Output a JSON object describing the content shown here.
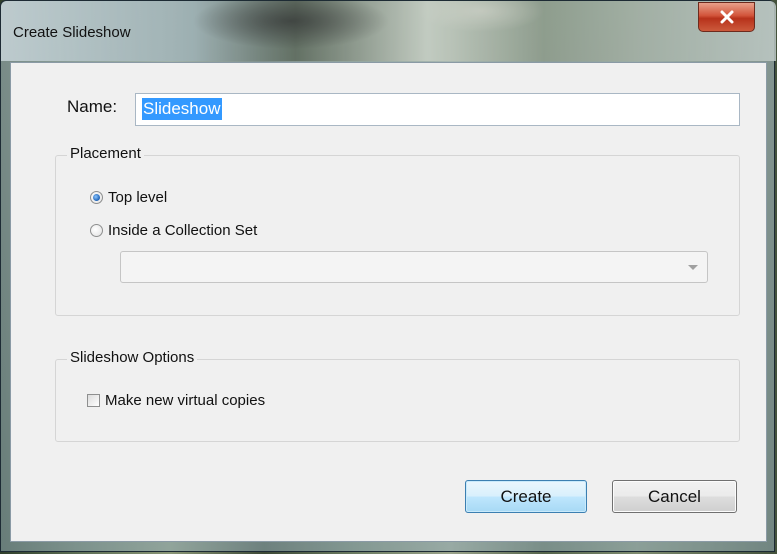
{
  "window": {
    "title": "Create Slideshow",
    "close_icon": "close-x-icon"
  },
  "name_field": {
    "label": "Name:",
    "value": "Slideshow",
    "value_selected": true
  },
  "placement": {
    "legend": "Placement",
    "options": [
      {
        "label": "Top level",
        "checked": true
      },
      {
        "label": "Inside a Collection Set",
        "checked": false
      }
    ],
    "collection_set_value": ""
  },
  "slideshow_options": {
    "legend": "Slideshow Options",
    "virtual_copies_label": "Make new virtual copies",
    "virtual_copies_checked": false
  },
  "buttons": {
    "create": "Create",
    "cancel": "Cancel"
  },
  "colors": {
    "selection": "#3399ff",
    "close_button": "#c7462f",
    "dialog_background": "#f0f0f0"
  }
}
